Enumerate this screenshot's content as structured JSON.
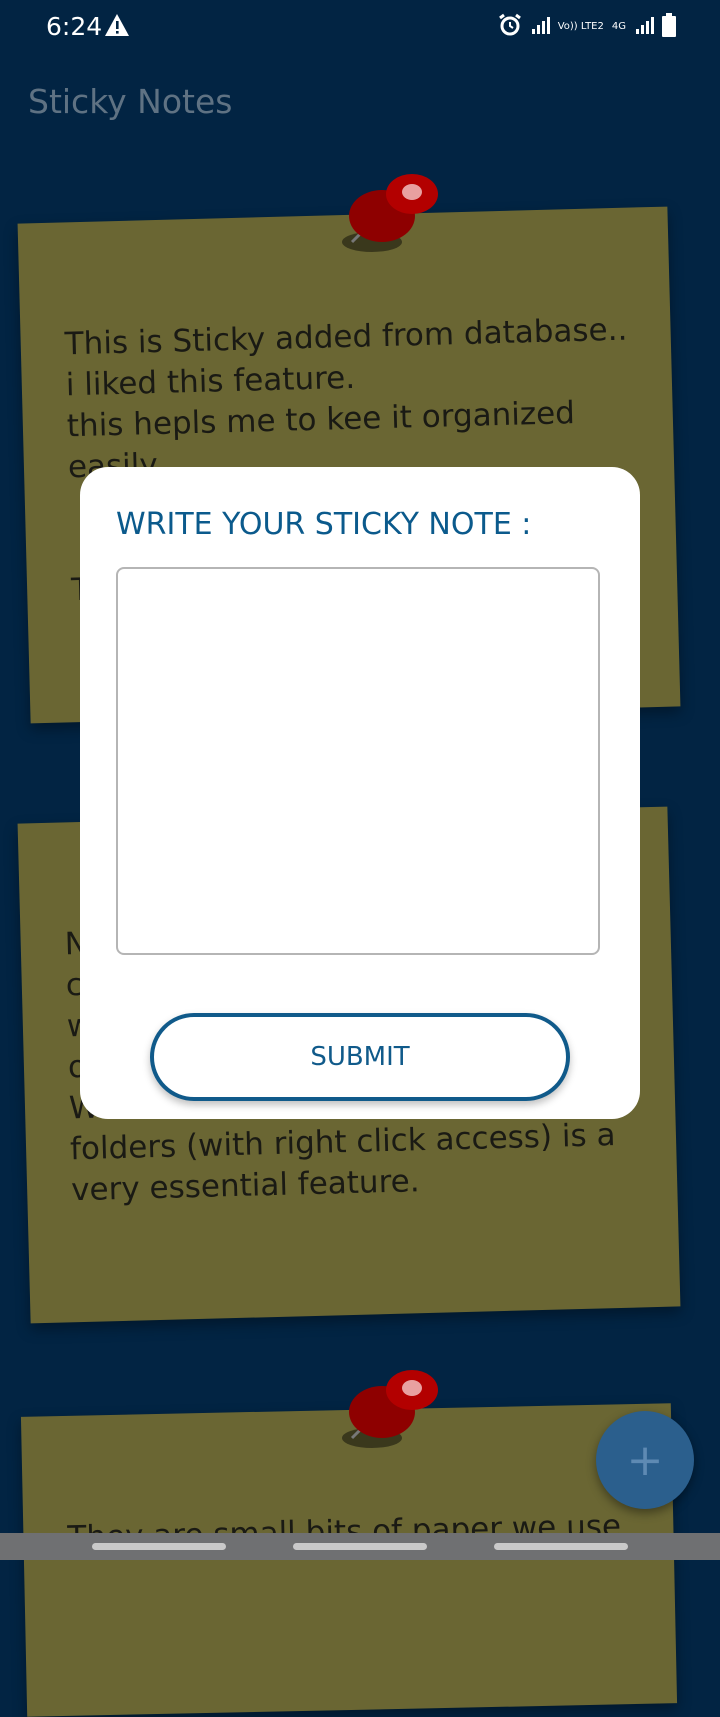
{
  "status_bar": {
    "time": "6:24",
    "network_top": "Vo)) LTE2",
    "network_label": "4G",
    "icons": [
      "warning-icon",
      "alarm-icon",
      "signal-icon",
      "signal-icon",
      "battery-icon"
    ]
  },
  "app": {
    "title": "Sticky Notes"
  },
  "notes": [
    {
      "text": "This is Sticky added from database..\ni liked this feature.\nthis hepls me to kee it organized\neasily..\n\n\nT"
    },
    {
      "text": "N\nc\nw\no                                              g\nW\nfolders (with right click access) is a\nvery essential feature."
    },
    {
      "text": "They are small bits of paper we use"
    }
  ],
  "dialog": {
    "title": "WRITE YOUR STICKY NOTE :",
    "input_value": "",
    "input_placeholder": "",
    "submit_label": "SUBMIT"
  },
  "fab": {
    "label": "+",
    "icon": "plus-icon"
  },
  "colors": {
    "background": "#022443",
    "note": "#6a6633",
    "accent": "#105a8a",
    "pin": "#a00000"
  }
}
